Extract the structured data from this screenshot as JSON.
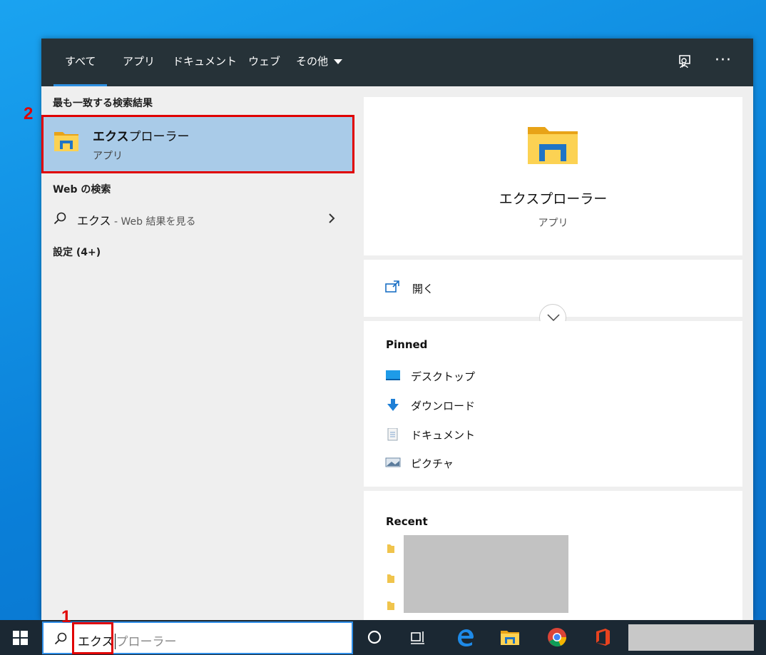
{
  "tabs": [
    {
      "label": "すべて",
      "active": true
    },
    {
      "label": "アプリ",
      "active": false
    },
    {
      "label": "ドキュメント",
      "active": false
    },
    {
      "label": "ウェブ",
      "active": false
    },
    {
      "label": "その他",
      "active": false
    }
  ],
  "topbar_icons": [
    "feedback-icon",
    "more-options-icon"
  ],
  "more_label": "···",
  "results": {
    "best_match_header": "最も一致する検索結果",
    "best_match": {
      "title_bold": "エクス",
      "title_rest": "プローラー",
      "subtitle": "アプリ",
      "icon": "file-explorer-icon"
    },
    "web_header": "Web の検索",
    "web_item": {
      "query": "エクス",
      "suffix": " - Web 結果を見る"
    },
    "settings_header": "設定 (4+)"
  },
  "preview": {
    "title": "エクスプローラー",
    "subtitle": "アプリ",
    "open_label": "開く",
    "pinned_header": "Pinned",
    "pinned": [
      {
        "label": "デスクトップ",
        "icon": "desktop-icon"
      },
      {
        "label": "ダウンロード",
        "icon": "download-icon"
      },
      {
        "label": "ドキュメント",
        "icon": "documents-icon"
      },
      {
        "label": "ピクチャ",
        "icon": "pictures-icon"
      }
    ],
    "recent_header": "Recent"
  },
  "search": {
    "typed": "エクス",
    "suggestion": "プローラー"
  },
  "annotations": {
    "step1": "1",
    "step2": "2"
  },
  "colors": {
    "topbar": "#263238",
    "selected_row": "#a9cbe8",
    "accent": "#2d8fe0",
    "annotation_red": "#e00000",
    "taskbar": "#1b2833"
  }
}
